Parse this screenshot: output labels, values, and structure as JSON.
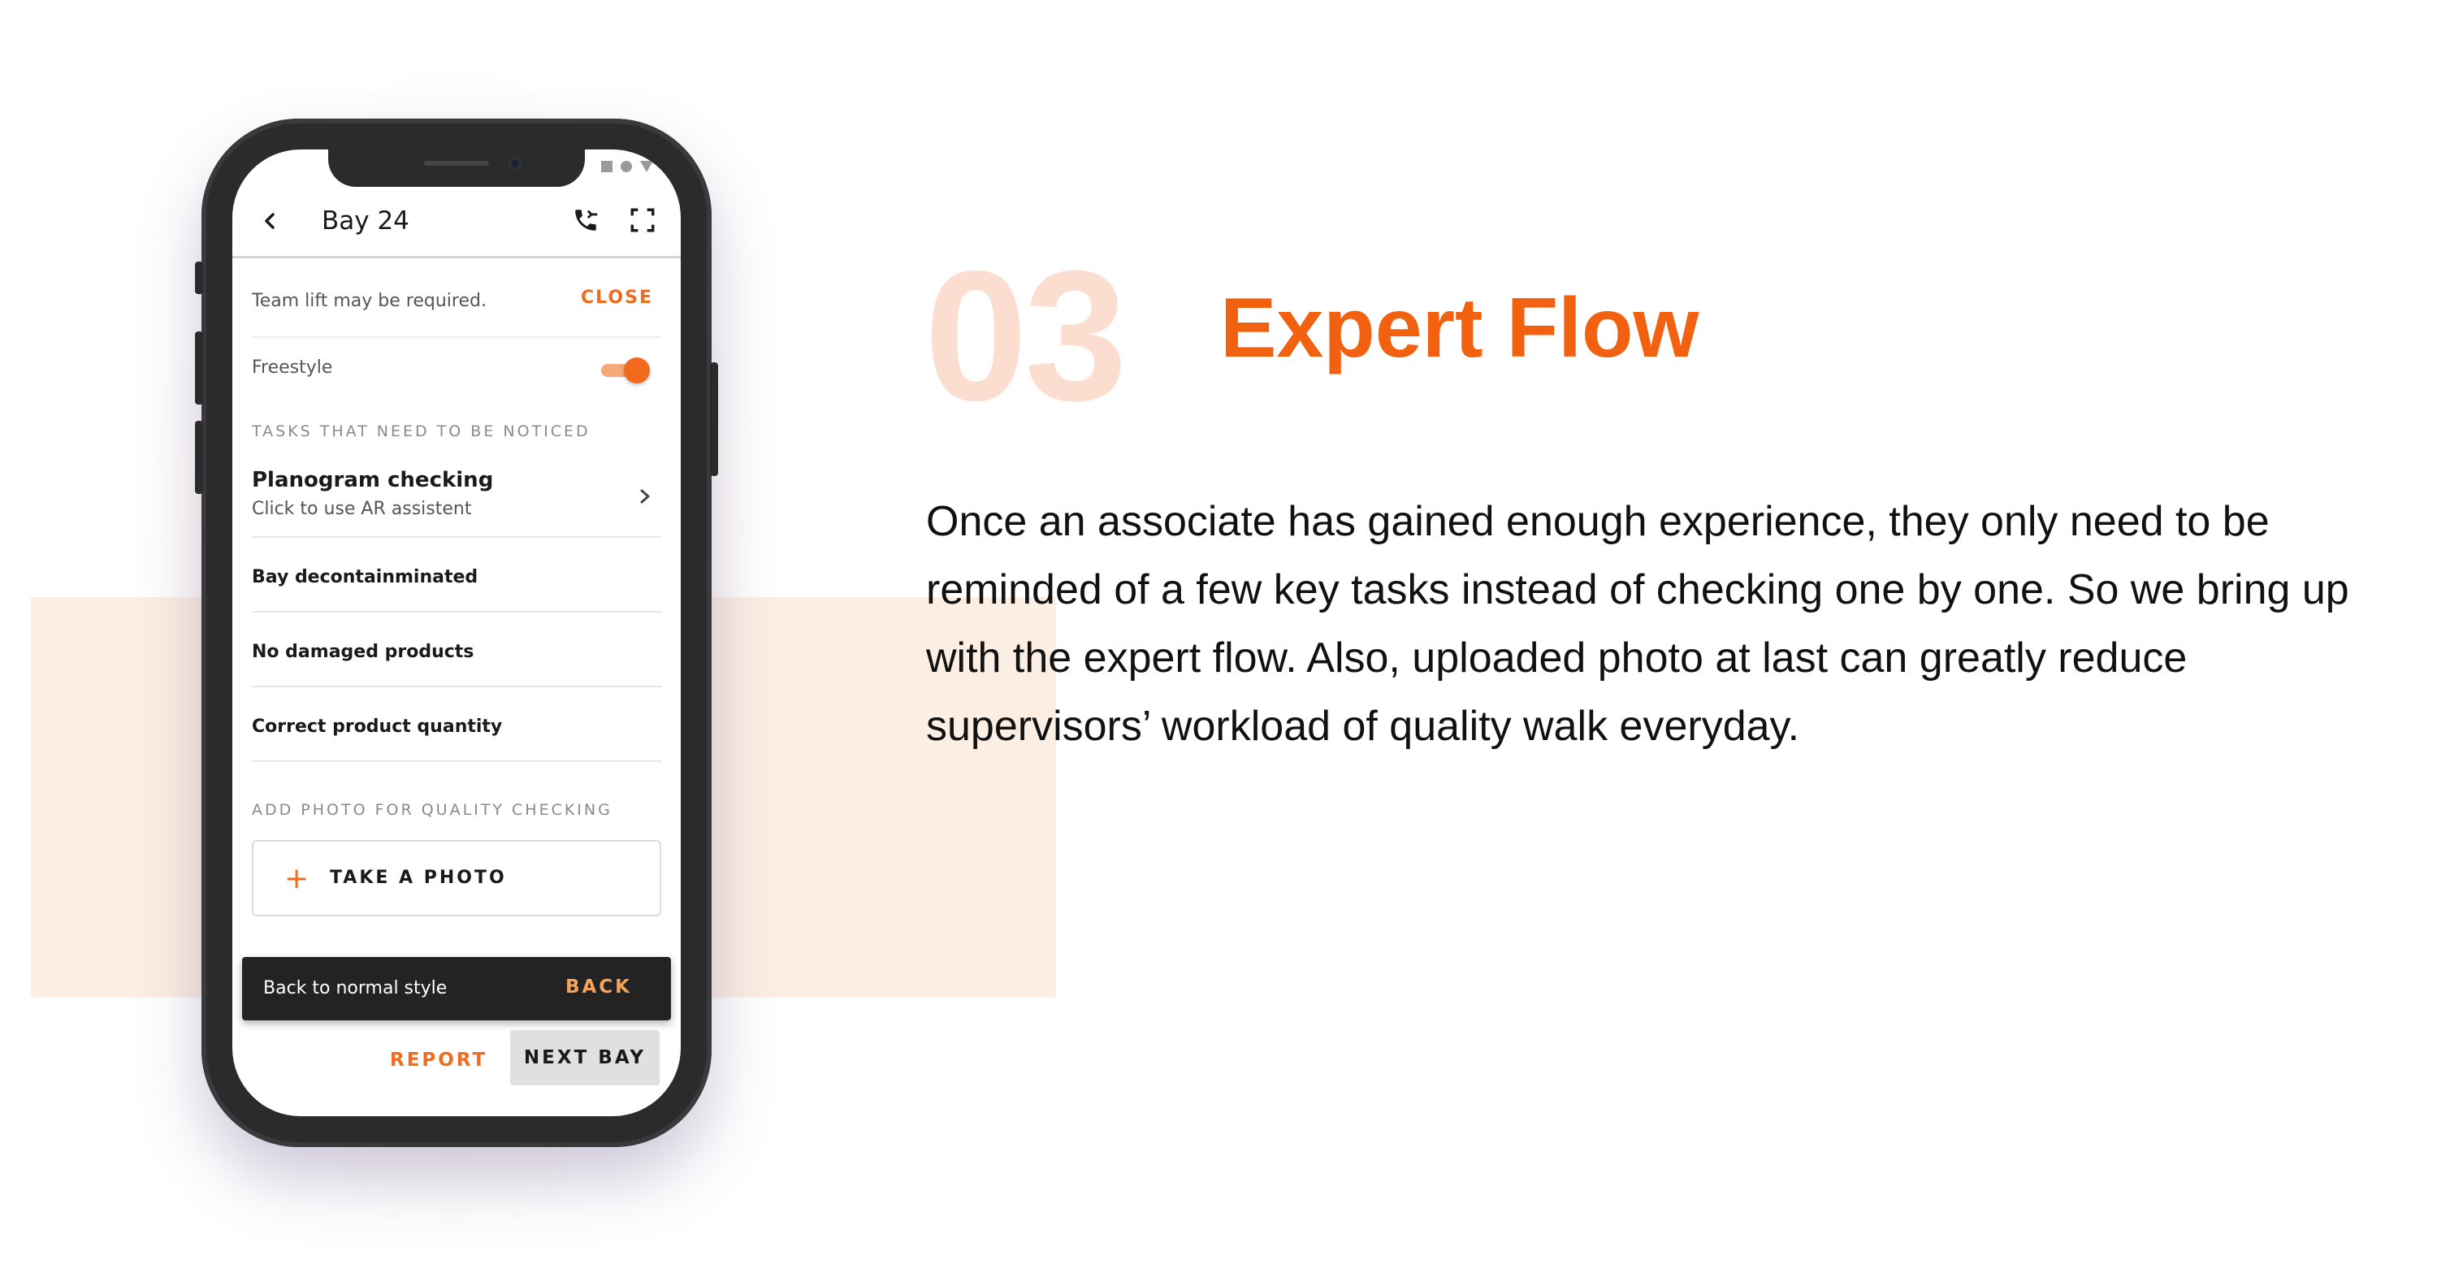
{
  "section": {
    "number": "03",
    "title": "Expert Flow",
    "description": "Once an associate has gained enough experience, they only need to be reminded of a few key tasks instead of checking one by one. So we bring up with the expert flow. Also, uploaded photo at last can greatly reduce supervisors’ workload of quality walk everyday."
  },
  "colors": {
    "accent": "#f26b1d",
    "accent_light": "#fcded0",
    "background_block": "#fdeee4",
    "snackbar": "#232323"
  },
  "app": {
    "header": {
      "title": "Bay 24",
      "icons": [
        "back-arrow-icon",
        "phone-forward-icon",
        "fullscreen-icon"
      ]
    },
    "notice": {
      "text": "Team lift may be required.",
      "action": "CLOSE"
    },
    "freestyle": {
      "label": "Freestyle",
      "enabled": true
    },
    "tasks_section": {
      "heading": "TASKS THAT NEED TO BE NOTICED",
      "main_task": {
        "title": "Planogram checking",
        "subtitle": "Click to use AR assistent"
      },
      "items": [
        "Bay decontainminated",
        "No damaged products",
        "Correct product quantity"
      ]
    },
    "photo_section": {
      "heading": "ADD PHOTO FOR QUALITY CHECKING",
      "button": "TAKE A PHOTO"
    },
    "snackbar": {
      "text": "Back to normal style",
      "action": "BACK"
    },
    "footer": {
      "report": "REPORT",
      "next": "NEXT BAY"
    }
  }
}
